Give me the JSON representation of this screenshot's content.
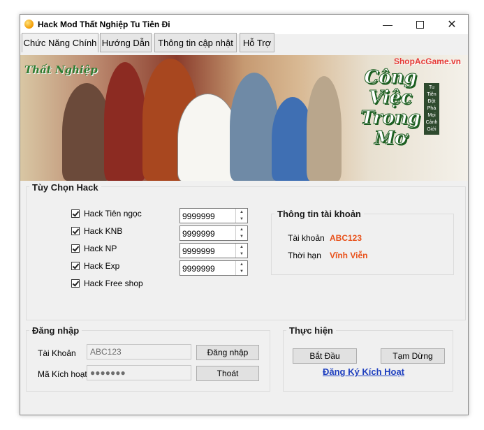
{
  "window": {
    "title": "Hack Mod Thất Nghiệp Tu Tiên Đi"
  },
  "tabs": [
    "Chức Năng Chính",
    "Hướng Dẫn",
    "Thông tin cập nhật",
    "Hỗ Trợ"
  ],
  "banner": {
    "game_logo": "Thất Nghiệp",
    "shop": "ShopAcGame.vn",
    "slogan": "Công Việc Trong Mơ",
    "side_text": "Tu Tiên Đột Phá Mọi Cảnh Giới"
  },
  "hack": {
    "title": "Tùy Chọn Hack",
    "options": [
      {
        "label": "Hack Tiên ngọc",
        "value": "9999999"
      },
      {
        "label": "Hack KNB",
        "value": "9999999"
      },
      {
        "label": "Hack NP",
        "value": "9999999"
      },
      {
        "label": "Hack Exp",
        "value": "9999999"
      },
      {
        "label": "Hack Free shop"
      }
    ]
  },
  "account": {
    "title": "Thông tin tài khoản",
    "account_label": "Tài khoản",
    "account_value": "ABC123",
    "duration_label": "Thời hạn",
    "duration_value": "Vĩnh Viễn"
  },
  "login": {
    "title": "Đăng nhập",
    "user_label": "Tài Khoản",
    "user_value": "ABC123",
    "code_label": "Mã Kích hoạt",
    "code_value": "●●●●●●●",
    "login_button": "Đăng nhập",
    "exit_button": "Thoát"
  },
  "action": {
    "title": "Thực hiện",
    "start_button": "Bắt Đầu",
    "pause_button": "Tạm Dừng",
    "register_link": "Đăng Ký Kích Hoạt"
  },
  "colors": {
    "value_orange": "#e8521c",
    "link_blue": "#1e3fbf"
  }
}
